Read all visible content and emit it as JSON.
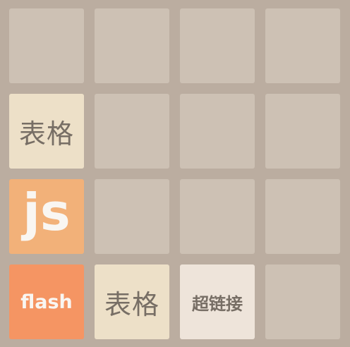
{
  "game": {
    "board_size": 4,
    "colors": {
      "board_background": "#bbada0",
      "empty_cell": "#cdc1b4",
      "tile_biaoge": "#ede0c8",
      "tile_js": "#f2b179",
      "tile_flash": "#f59563",
      "tile_link": "#eee4da",
      "dark_text": "#776e65",
      "light_text": "#f9f6f2"
    },
    "tiles": [
      {
        "row": 2,
        "col": 1,
        "label": "表格"
      },
      {
        "row": 3,
        "col": 1,
        "label": "js"
      },
      {
        "row": 4,
        "col": 1,
        "label": "flash"
      },
      {
        "row": 4,
        "col": 2,
        "label": "表格"
      },
      {
        "row": 4,
        "col": 3,
        "label": "超链接"
      }
    ]
  }
}
